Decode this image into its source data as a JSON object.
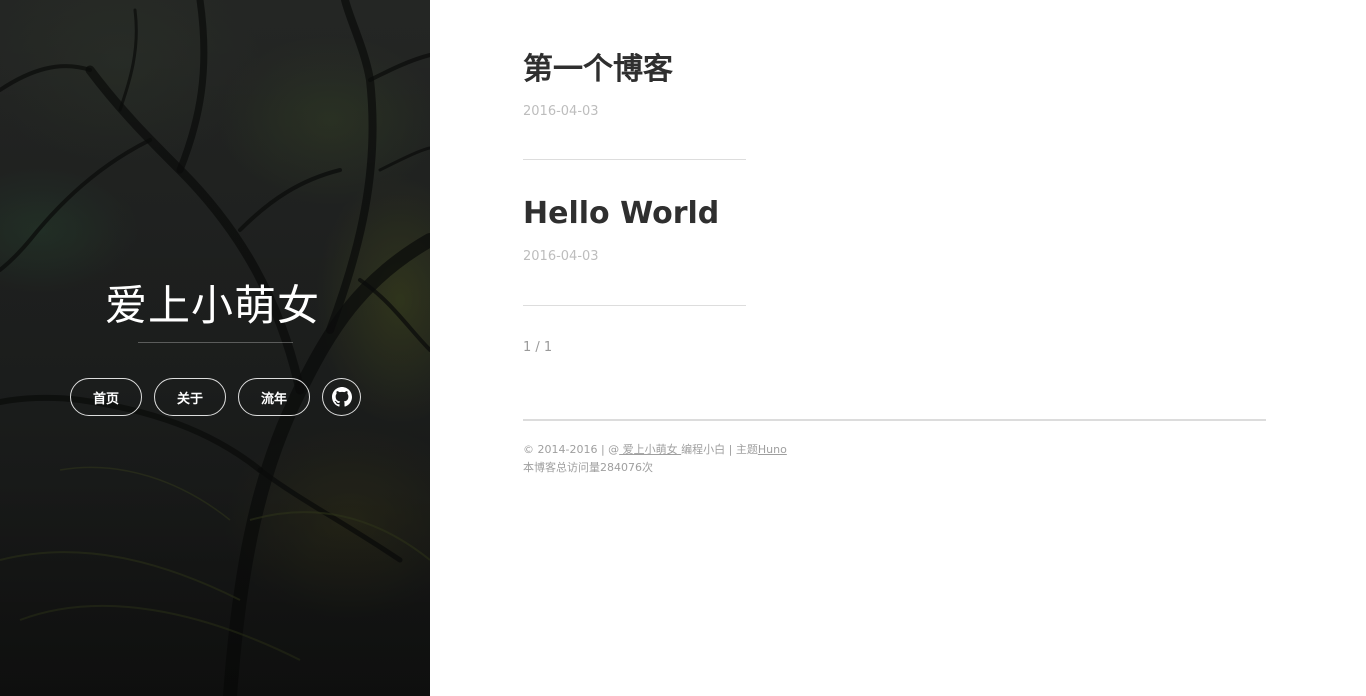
{
  "sidebar": {
    "title": "爱上小萌女",
    "nav": [
      {
        "label": "首页"
      },
      {
        "label": "关于"
      },
      {
        "label": "流年"
      }
    ],
    "github_icon": "github-icon"
  },
  "posts": [
    {
      "title": "第一个博客",
      "date": "2016-04-03"
    },
    {
      "title": "Hello World",
      "date": "2016-04-03"
    }
  ],
  "pagination": {
    "text": "1 / 1"
  },
  "footer": {
    "copyright": "© 2014-2016 | @",
    "author_link": " 爱上小萌女 ",
    "author_suffix": "编程小白 | 主题",
    "theme_link": "Huno",
    "visits": "本博客总访问量284076次"
  },
  "colors": {
    "title_text": "#2f2f2f",
    "date_text": "#bdbdbd",
    "footer_text": "#9f9f9f",
    "hero_text": "#ffffff"
  }
}
